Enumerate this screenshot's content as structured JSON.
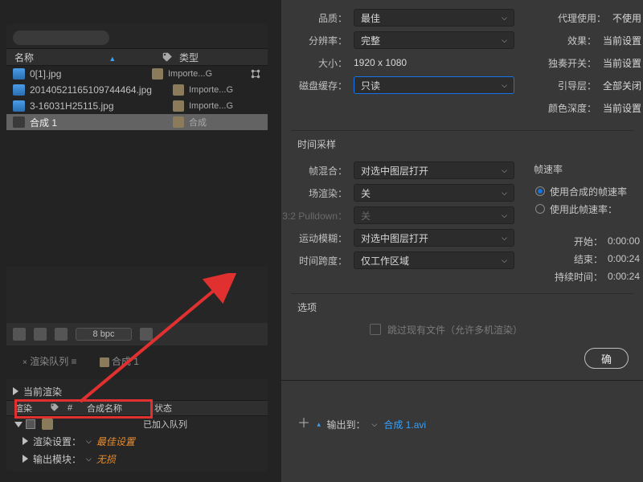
{
  "project": {
    "cols": {
      "name": "名称",
      "type": "类型"
    },
    "items": [
      {
        "name": "0[1].jpg",
        "type": "Importe...G",
        "comp": false
      },
      {
        "name": "20140521165109744464.jpg",
        "type": "Importe...G",
        "comp": false
      },
      {
        "name": "3-16031H25115.jpg",
        "type": "Importe...G",
        "comp": false
      },
      {
        "name": "合成 1",
        "type": "合成",
        "comp": true,
        "selected": true
      }
    ],
    "bpc": "8 bpc"
  },
  "tabs": {
    "render_queue": "渲染队列",
    "comp1": "合成 1"
  },
  "queue": {
    "current_render": "当前渲染",
    "cols": {
      "render": "渲染",
      "num": "#",
      "comp": "合成名称",
      "status": "状态"
    },
    "row": {
      "status": "已加入队列"
    },
    "render_settings_label": "渲染设置：",
    "render_settings_value": "最佳设置",
    "output_module_label": "输出模块：",
    "output_module_value": "无损",
    "output_to_label": "输出到：",
    "output_to_value": "合成 1.avi"
  },
  "settings": {
    "quality_label": "品质：",
    "quality": "最佳",
    "resolution_label": "分辨率：",
    "resolution": "完整",
    "size_label": "大小：",
    "size": "1920 x 1080",
    "disk_cache_label": "磁盘缓存：",
    "disk_cache": "只读",
    "proxy_label": "代理使用：",
    "proxy": "不使用",
    "effects_label": "效果：",
    "effects": "当前设置",
    "solo_label": "独奏开关：",
    "solo": "当前设置",
    "guide_label": "引导层：",
    "guide": "全部关闭",
    "depth_label": "颜色深度：",
    "depth": "当前设置"
  },
  "time_sampling": {
    "title": "时间采样",
    "frame_blend_label": "帧混合：",
    "frame_blend": "对选中图层打开",
    "field_render_label": "场渲染：",
    "field_render": "关",
    "pulldown_label": "3:2 Pulldown：",
    "pulldown": "关",
    "motion_blur_label": "运动模糊：",
    "motion_blur": "对选中图层打开",
    "time_span_label": "时间跨度：",
    "time_span": "仅工作区域"
  },
  "frame_rate": {
    "title": "帧速率",
    "opt1": "使用合成的帧速率",
    "opt2": "使用此帧速率："
  },
  "time_info": {
    "start_label": "开始：",
    "start": "0:00:00",
    "end_label": "结束：",
    "end": "0:00:24",
    "duration_label": "持续时间：",
    "duration": "0:00:24"
  },
  "options": {
    "title": "选项",
    "skip_existing": "跳过现有文件（允许多机渲染）"
  },
  "buttons": {
    "ok": "确"
  }
}
